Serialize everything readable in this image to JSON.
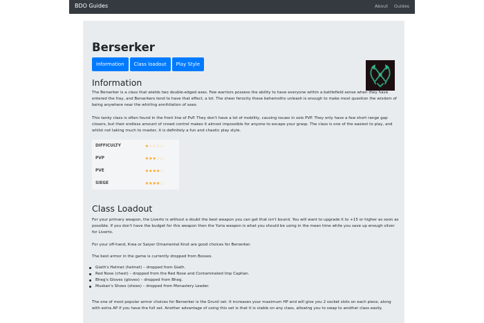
{
  "navbar": {
    "brand": "BDO Guides",
    "links": [
      "About",
      "Guides"
    ]
  },
  "page": {
    "title": "Berserker",
    "buttons": [
      "Information",
      "Class loadout",
      "Play Style"
    ]
  },
  "information": {
    "heading": "Information",
    "p1": "The Berserker is a class that wields two double-edged axes. Few warriors possess the ability to have everyone within a battlefield sense when they have entered the fray, and Berserkers tend to have that effect, a lot. The sheer ferocity these behemoths unleash is enough to make most question the wisdom of being anywhere near the whirling annihilation of axes.",
    "p2": "This tanky class is often found in the front line of PvP. They don't have a lot of mobility, causing issues in solo PVP. They only have a few short range gap closers, but their endless amount of crowd control makes it almost impossible for anyone to escape your grasp. The class is one of the easiest to play, and whilst not taking much to master, it is definitely a fun and chaotic play style.",
    "ratings": [
      {
        "label": "DIFFICULTY",
        "stars": 1,
        "max": 5
      },
      {
        "label": "PVP",
        "stars": 3,
        "max": 5
      },
      {
        "label": "PVE",
        "stars": 4,
        "max": 5
      },
      {
        "label": "SIEGE",
        "stars": 4,
        "max": 5
      }
    ]
  },
  "loadout": {
    "heading": "Class Loadout",
    "p1": "For your primary weapon, the Liverto is without a doubt the best weapon you can get that isn't bound. You will want to upgrade it to +15 or higher as soon as possible. If you don't have the budget for this weapon then the Yuria weapon is what you should be using in the mean time while you save up enough silver for Liverto.",
    "p2": "For your off-hand, Krea or Saiyer Ornamental Knot are good choices for Berserker.",
    "p3": "The best armor in the game is currently dropped from Bosses.",
    "armor": [
      "Giath's Helmet (helmet) – dropped from Giath.",
      "Red Nose (chest) – dropped from the Red Nose and Contaminated Imp Captian.",
      "Bheg's Gloves (gloves) – dropped from Bheg.",
      "Muskan's Shoes (shoes) – dropped from Monastery Leader."
    ],
    "p4": "The one of most popular armor choices for Berserker is the Grunil set. It increases your maximum HP and will give you 2 socket slots on each piece, along with extra AP if you have the full set. Another advantage of using this set is that it is viable on any class, allowing you to swap to another class easily."
  },
  "colors": {
    "navbar": "#343a40",
    "jumbotron": "#e9ecef",
    "button": "#007bff",
    "star": "#f5a623"
  },
  "icons": {
    "class_logo": "berserker-emblem-icon"
  }
}
